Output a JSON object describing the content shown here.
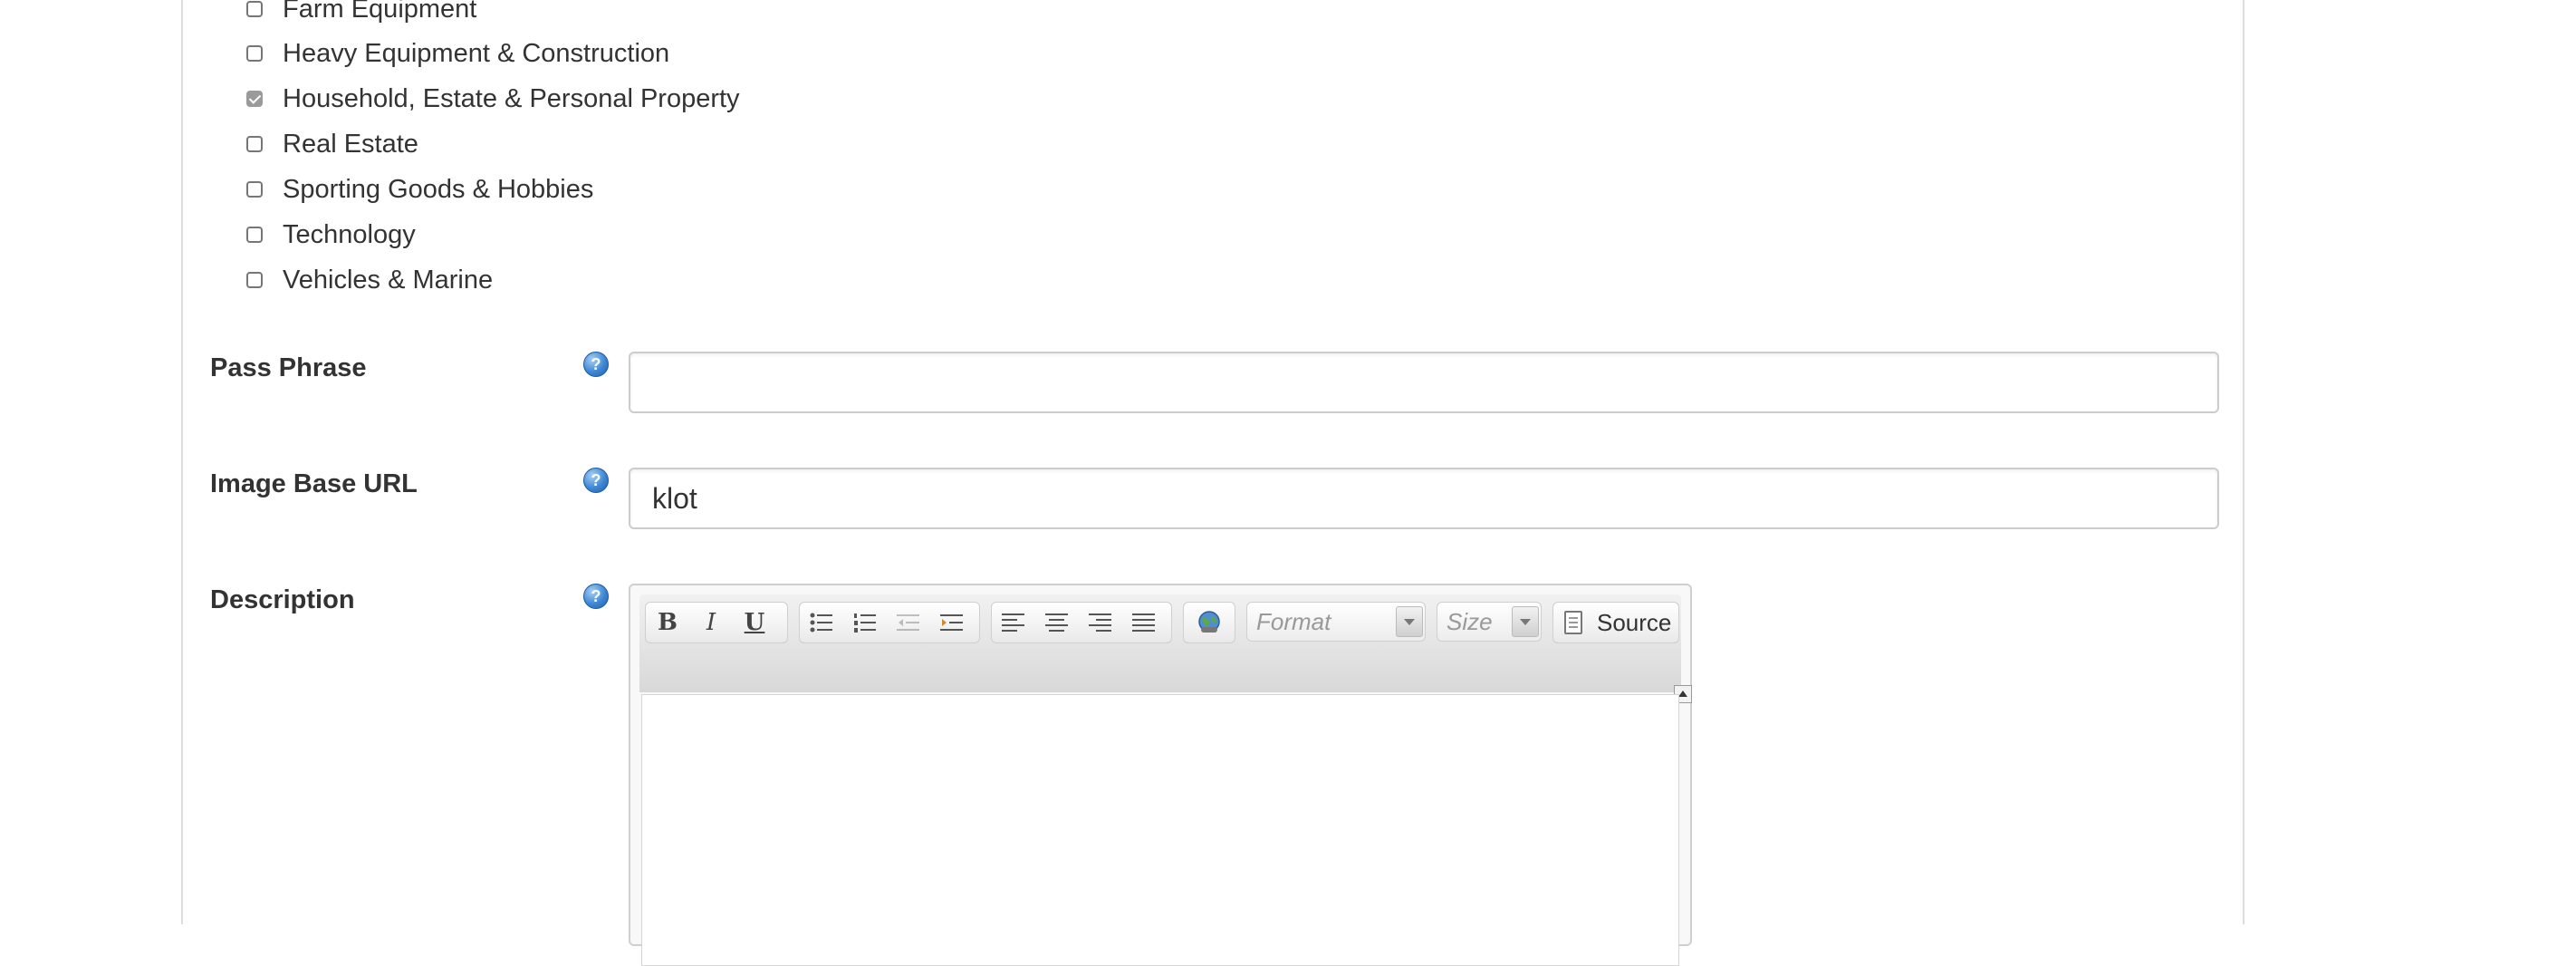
{
  "categories": [
    {
      "label": "Farm Equipment",
      "checked": false
    },
    {
      "label": "Heavy Equipment & Construction",
      "checked": false
    },
    {
      "label": "Household, Estate & Personal Property",
      "checked": true
    },
    {
      "label": "Real Estate",
      "checked": false
    },
    {
      "label": "Sporting Goods & Hobbies",
      "checked": false
    },
    {
      "label": "Technology",
      "checked": false
    },
    {
      "label": "Vehicles & Marine",
      "checked": false
    }
  ],
  "fields": {
    "pass_phrase": {
      "label": "Pass Phrase",
      "value": ""
    },
    "image_base_url": {
      "label": "Image Base URL",
      "value": "klot"
    },
    "description": {
      "label": "Description"
    }
  },
  "help_icon": {
    "glyph": "?",
    "icon": "help-icon"
  },
  "editor": {
    "format_label": "Format",
    "size_label": "Size",
    "source_label": "Source"
  },
  "colors": {
    "help_icon": "#3d87d4",
    "input_border": "#cccccc",
    "checked_box": "#9a9a9a"
  }
}
